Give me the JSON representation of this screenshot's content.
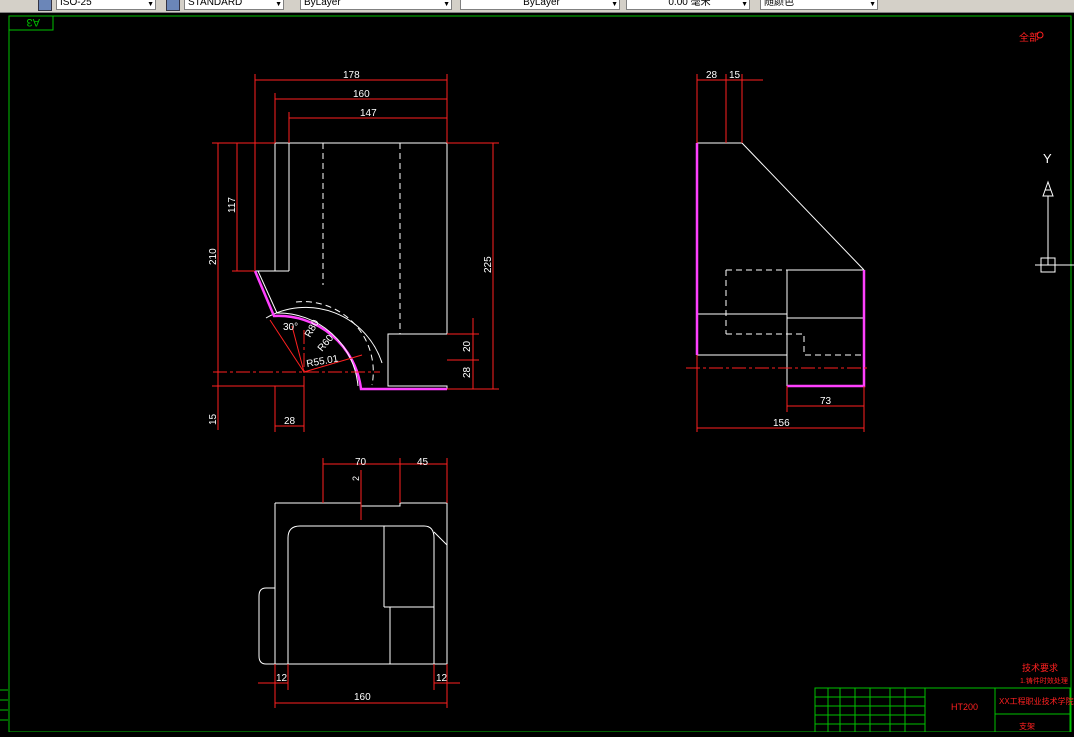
{
  "toolbar": {
    "style_value": "ISO-25",
    "style2_value": "STANDARD",
    "layer_value": "ByLayer",
    "linetype_value": "ByLayer",
    "lineweight_value": "0.00 毫米",
    "color_value": "随颜色"
  },
  "colors": {
    "background": "#000000",
    "frame": "#00c000",
    "dimension": "#ff2020",
    "outline": "#ffffff",
    "highlight": "#ff40ff"
  },
  "drawing": {
    "corner_label": "A3",
    "roughness_label": "全部",
    "ucs_y_label": "Y",
    "front_dims": {
      "top_178": "178",
      "top_160": "160",
      "top_147": "147",
      "left_117": "117",
      "left_210": "210",
      "right_225": "225",
      "right_20": "20",
      "right_28": "28",
      "bottom_15": "15",
      "bottom_28": "28",
      "angle_30": "30°",
      "radius_r80": "R80",
      "radius_r60": "R60",
      "radius_r55": "R55.01"
    },
    "side_dims": {
      "top_28": "28",
      "top_15": "15",
      "bottom_73": "73",
      "bottom_156": "156"
    },
    "plan_dims": {
      "top_70": "70",
      "top_45": "45",
      "depth_2": "2",
      "bottom_12_left": "12",
      "bottom_12_right": "12",
      "bottom_160": "160"
    },
    "title_block": {
      "tech_req_title": "技术要求",
      "tech_req_line": "1.铸件时效处理",
      "material": "HT200",
      "school": "XX工程职业技术学院",
      "part_name": "支架"
    }
  }
}
